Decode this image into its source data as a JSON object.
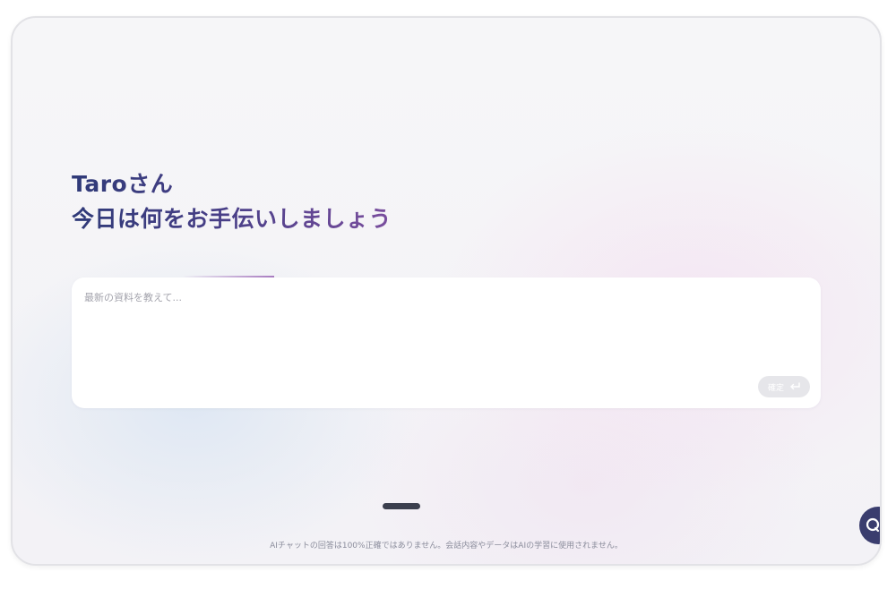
{
  "greeting": {
    "line1": "Taroさん",
    "line2": "今日は何をお手伝いしましょう"
  },
  "prompt": {
    "placeholder": "最新の資料を教えて...",
    "value": ""
  },
  "submit": {
    "label": "確定",
    "icon": "enter-arrow-icon"
  },
  "footer": {
    "disclaimer": "AIチャットの回答は100%正確ではありません。会話内容やデータはAIの学習に使用されません。"
  },
  "chat_button": {
    "icon": "chat-bubble-icon"
  },
  "colors": {
    "greeting_start": "#2f3a78",
    "greeting_end": "#7a4e9e",
    "chat_button": "#3a3d6e",
    "home_indicator": "#3b3f4e"
  }
}
